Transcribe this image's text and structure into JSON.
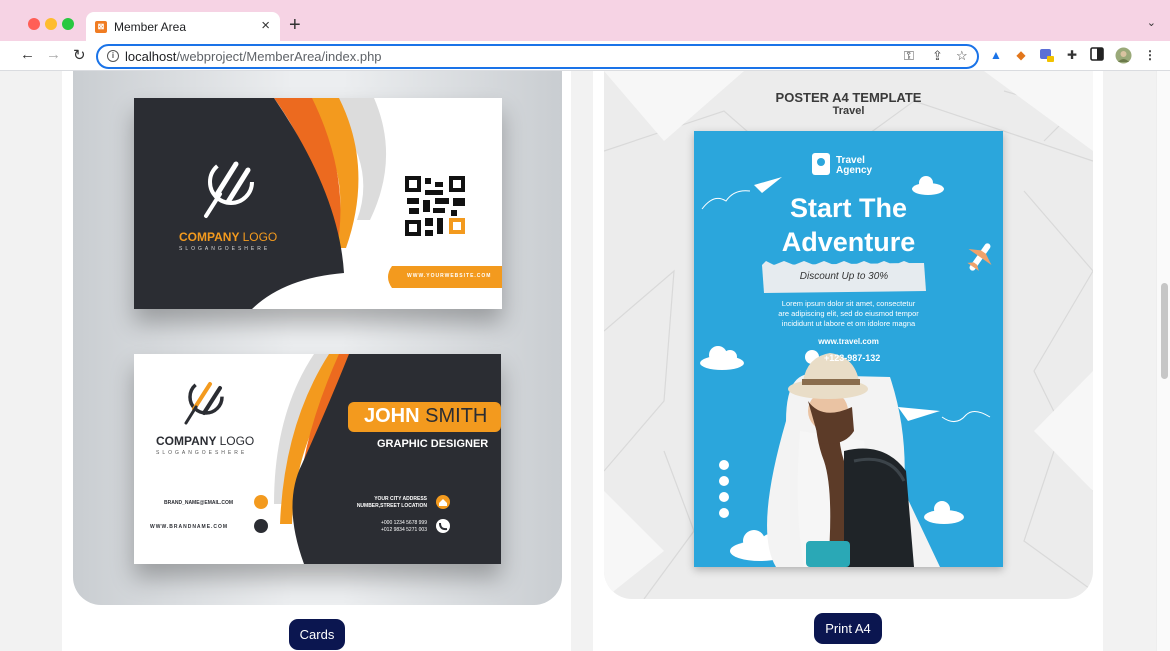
{
  "browser": {
    "tab_title": "Member Area",
    "tab_close": "×",
    "new_tab": "+",
    "tab_menu": "⌄",
    "url_host": "localhost",
    "url_path": "/webproject/MemberArea/index.php"
  },
  "cards_panel": {
    "card_front": {
      "logo_company": "COMPANY",
      "logo_word": "LOGO",
      "slogan": "SLOGANGOESHERE",
      "website": "WWW.YOURWEBSITE.COM"
    },
    "card_back": {
      "logo_company": "COMPANY",
      "logo_word": "LOGO",
      "slogan": "SLOGANGOESHERE",
      "first_name": "JOHN",
      "last_name": "SMITH",
      "job_title": "GRAPHIC DESIGNER",
      "email": "BRAND_NAME@EMAIL.COM",
      "web": "WWW.BRANDNAME.COM",
      "address_line1": "YOUR CITY ADDRESS",
      "address_line2": "NUMBER,STREET LOCATION",
      "phone1": "+000 1234 5678 999",
      "phone2": "+012 9834 5271 003"
    },
    "button_label": "Cards"
  },
  "poster_panel": {
    "heading": "POSTER A4 TEMPLATE",
    "subheading": "Travel",
    "poster": {
      "brand_line1": "Travel",
      "brand_line2": "Agency",
      "headline_line1": "Start The",
      "headline_line2": "Adventure",
      "discount": "Discount Up to 30%",
      "body_line1": "Lorem ipsum dolor sit amet, consectetur",
      "body_line2": "are adipiscing elit, sed do eiusmod tempor",
      "body_line3": "incididunt ut labore et om idolore magna",
      "website": "www.travel.com",
      "phone": "+123-987-132"
    },
    "button_label": "Print A4"
  },
  "colors": {
    "tab_bar": "#f6d3e4",
    "button": "#0b1650",
    "orange": "#f39a1e",
    "dark_orange": "#ec6a1f",
    "card_dark": "#2b2d33",
    "poster_blue": "#2ba6dc"
  }
}
